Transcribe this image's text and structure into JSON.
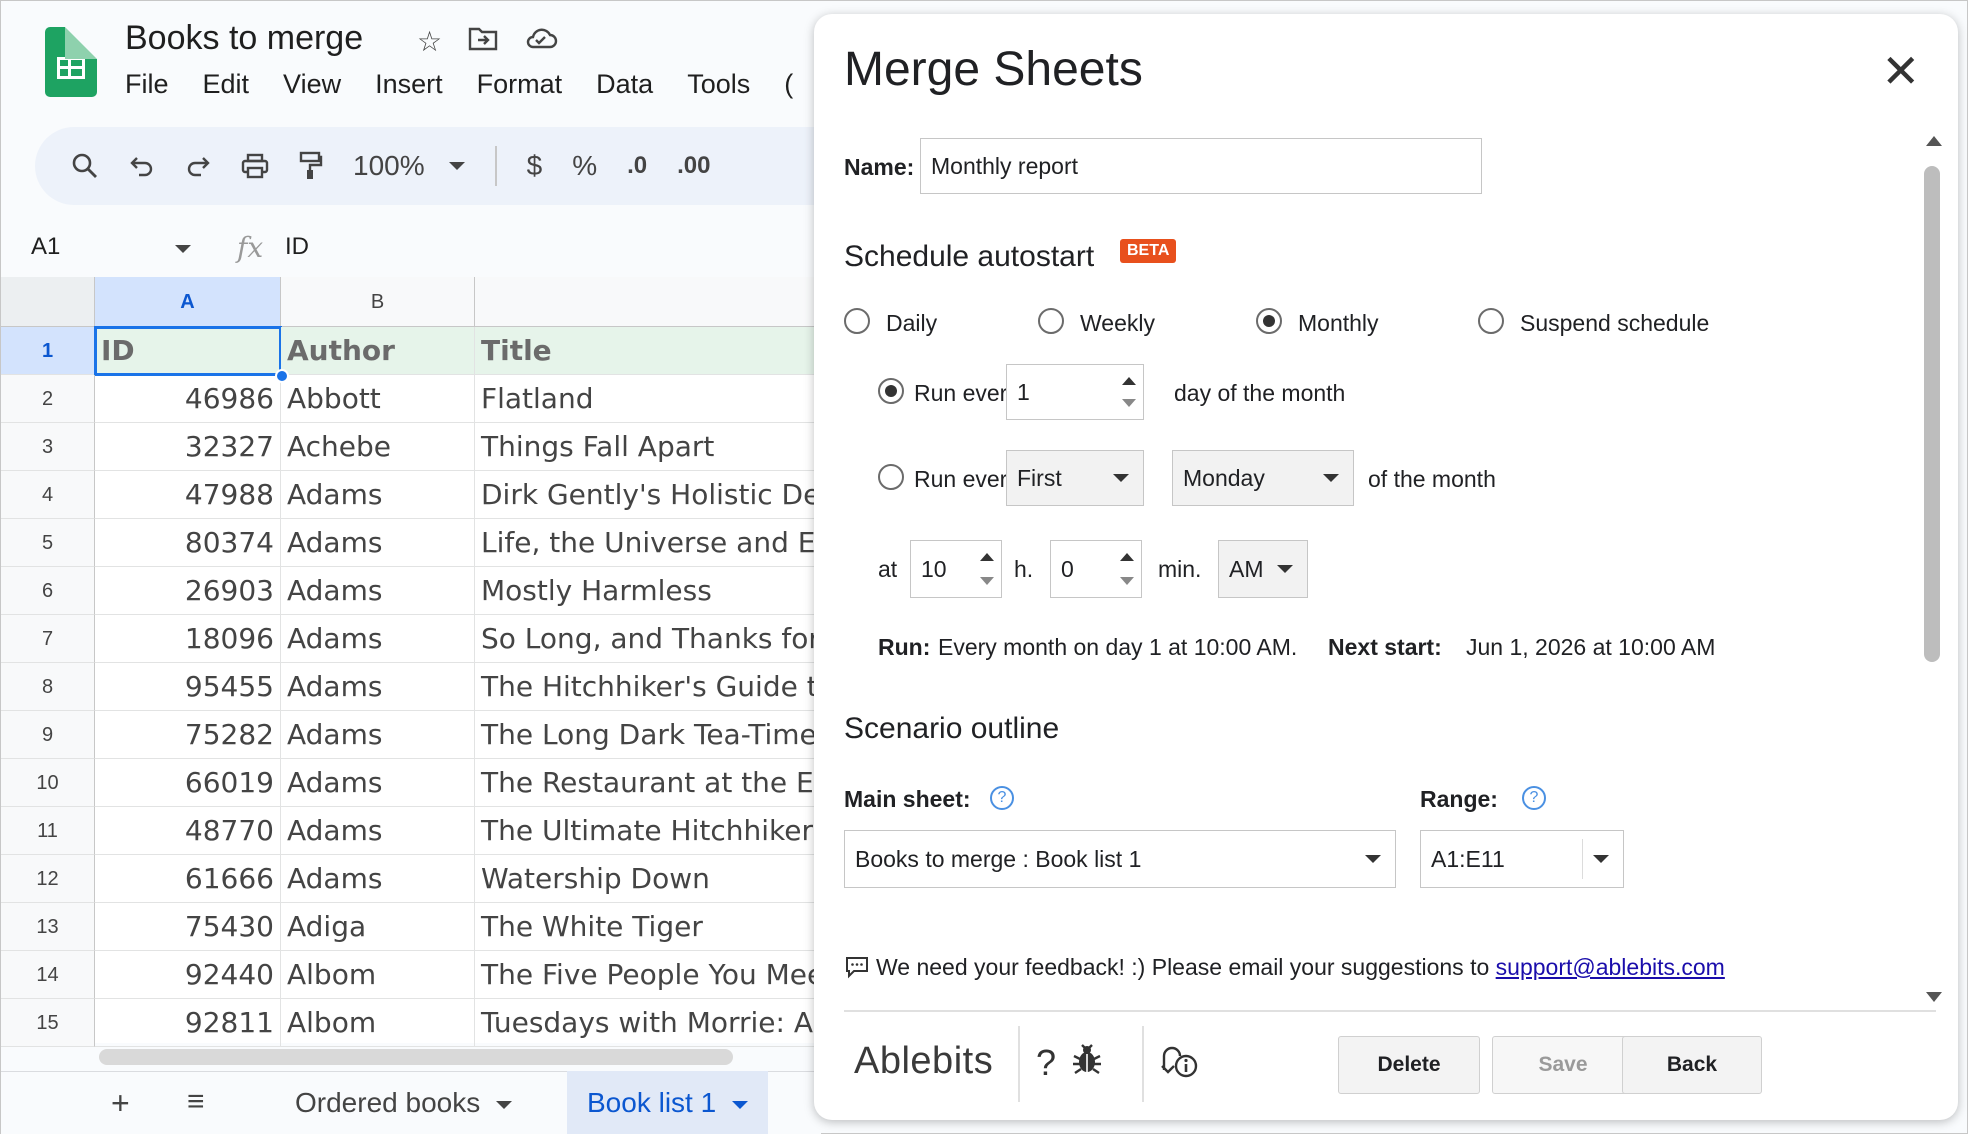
{
  "app": {
    "doc_title": "Books to merge",
    "menu": [
      "File",
      "Edit",
      "View",
      "Insert",
      "Format",
      "Data",
      "Tools",
      "("
    ],
    "toolbar": {
      "zoom": "100%",
      "currency": "$",
      "percent": "%",
      "dec_decrease": ".0",
      "dec_increase": ".00"
    },
    "name_box": "A1",
    "formula": "ID",
    "fx_glyph": "fx",
    "columns": [
      "A",
      "B"
    ],
    "rows": [
      {
        "n": "1",
        "id": "ID",
        "author": "Author",
        "title": "Title"
      },
      {
        "n": "2",
        "id": "46986",
        "author": "Abbott",
        "title": "Flatland"
      },
      {
        "n": "3",
        "id": "32327",
        "author": "Achebe",
        "title": "Things Fall Apart"
      },
      {
        "n": "4",
        "id": "47988",
        "author": "Adams",
        "title": "Dirk Gently's Holistic Dete"
      },
      {
        "n": "5",
        "id": "80374",
        "author": "Adams",
        "title": "Life, the Universe and Eve"
      },
      {
        "n": "6",
        "id": "26903",
        "author": "Adams",
        "title": "Mostly Harmless"
      },
      {
        "n": "7",
        "id": "18096",
        "author": "Adams",
        "title": "So Long, and Thanks for A"
      },
      {
        "n": "8",
        "id": "95455",
        "author": "Adams",
        "title": "The Hitchhiker's Guide to"
      },
      {
        "n": "9",
        "id": "75282",
        "author": "Adams",
        "title": "The Long Dark Tea-Time o"
      },
      {
        "n": "10",
        "id": "66019",
        "author": "Adams",
        "title": "The Restaurant at the End"
      },
      {
        "n": "11",
        "id": "48770",
        "author": "Adams",
        "title": "The Ultimate Hitchhiker's"
      },
      {
        "n": "12",
        "id": "61666",
        "author": "Adams",
        "title": "Watership Down"
      },
      {
        "n": "13",
        "id": "75430",
        "author": "Adiga",
        "title": "The White Tiger"
      },
      {
        "n": "14",
        "id": "92440",
        "author": "Albom",
        "title": "The Five People You Meet"
      },
      {
        "n": "15",
        "id": "92811",
        "author": "Albom",
        "title": "Tuesdays with Morrie: An"
      }
    ],
    "sheet_tabs": {
      "add": "+",
      "list": "≡",
      "tab1": "Ordered books",
      "tab2": "Book list 1"
    }
  },
  "dialog": {
    "title": "Merge Sheets",
    "close": "✕",
    "name_label": "Name:",
    "name_value": "Monthly report",
    "schedule_title": "Schedule autostart",
    "beta": "BETA",
    "freq": {
      "daily": "Daily",
      "weekly": "Weekly",
      "monthly": "Monthly",
      "suspend": "Suspend schedule",
      "selected": "monthly"
    },
    "run_every_label": "Run every",
    "day_value": "1",
    "day_suffix": "day of the month",
    "run_every_label2": "Run every",
    "ordinal": "First",
    "weekday": "Monday",
    "of_month": "of the month",
    "at_label": "at",
    "hour": "10",
    "h_label": "h.",
    "minute": "0",
    "min_label": "min.",
    "ampm": "AM",
    "run_label": "Run:",
    "run_text": "Every month on day 1 at 10:00 AM.",
    "next_label": "Next start:",
    "next_text": "Jun 1, 2026 at 10:00 AM",
    "outline_title": "Scenario outline",
    "main_sheet_label": "Main sheet:",
    "main_sheet_value": "Books to merge : Book list 1",
    "range_label": "Range:",
    "range_value": "A1:E11",
    "help": "?",
    "feedback_text": "We need your feedback! :) Please email your suggestions to",
    "feedback_link": "support@ablebits.com",
    "brand": "Ablebits",
    "footer_help": "?",
    "delete": "Delete",
    "save": "Save",
    "back": "Back"
  },
  "colors": {
    "sheets_green": "#1ea362",
    "selection_blue": "#1a73e8",
    "beta_orange": "#e8501d",
    "active_tab": "#0b57d0"
  }
}
